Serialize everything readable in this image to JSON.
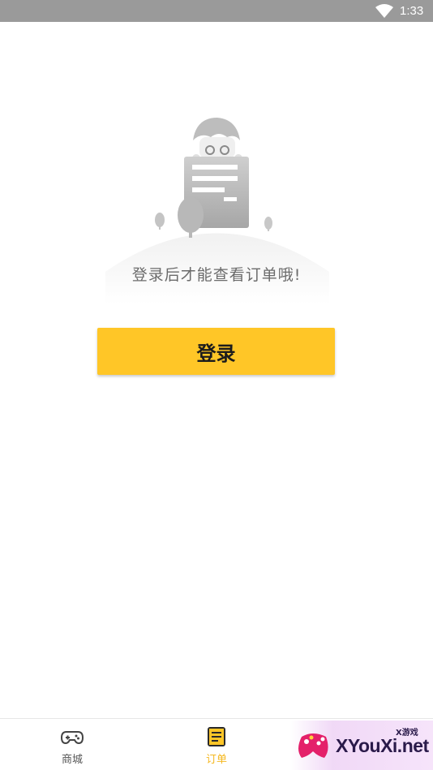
{
  "status_bar": {
    "time": "1:33",
    "wifi_icon": "wifi-icon"
  },
  "empty_state": {
    "illustration": "empty-orders-illustration",
    "message": "登录后才能查看订单哦!"
  },
  "login_button": {
    "label": "登录",
    "color": "#ffc627"
  },
  "bottom_nav": {
    "items": [
      {
        "label": "商城",
        "icon": "gamepad-icon",
        "active": false
      },
      {
        "label": "订单",
        "icon": "order-list-icon",
        "active": true
      },
      {
        "label": "",
        "icon": "",
        "active": false
      }
    ],
    "active_color": "#f5b820"
  },
  "watermark": {
    "site": "XYouXi.net",
    "tag": "X游戏"
  }
}
